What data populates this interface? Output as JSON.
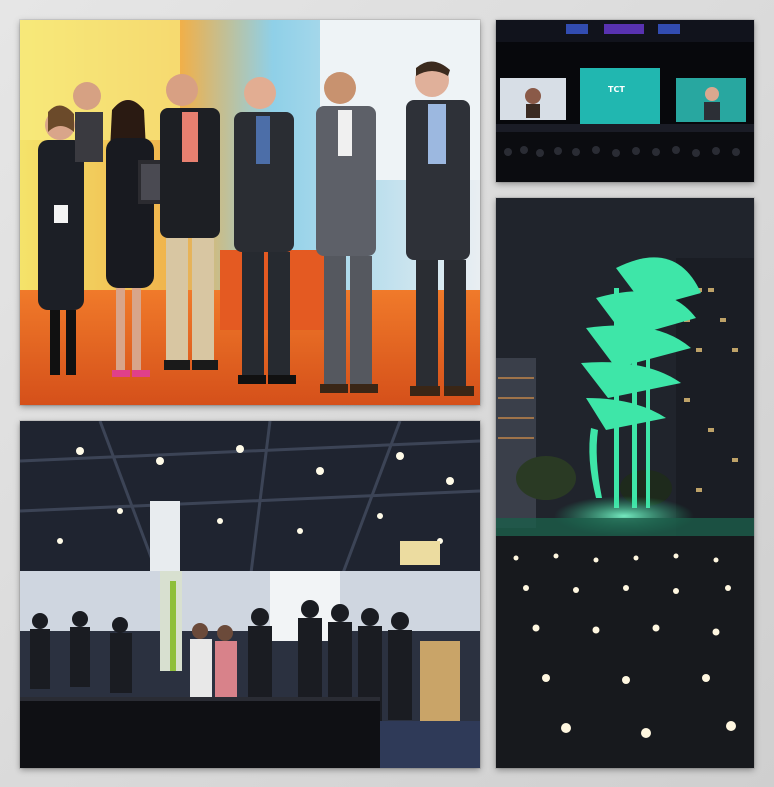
{
  "collage": {
    "background": "#d9d9d9",
    "tiles": [
      {
        "id": "team-photo",
        "icon": "group-photo-icon"
      },
      {
        "id": "keynote-stage",
        "icon": "stage-screens-icon",
        "screen_logo_text": "TCT"
      },
      {
        "id": "night-sculpture",
        "icon": "sculpture-icon",
        "accent": "#3ee6a8"
      },
      {
        "id": "exhibit-hall",
        "icon": "crowd-icon"
      }
    ]
  },
  "colors": {
    "carpet": "#e8651e",
    "sculpture_glow": "#3ee6a8",
    "stage_screen": "#21b7b0",
    "night_sky": "#20242c"
  }
}
